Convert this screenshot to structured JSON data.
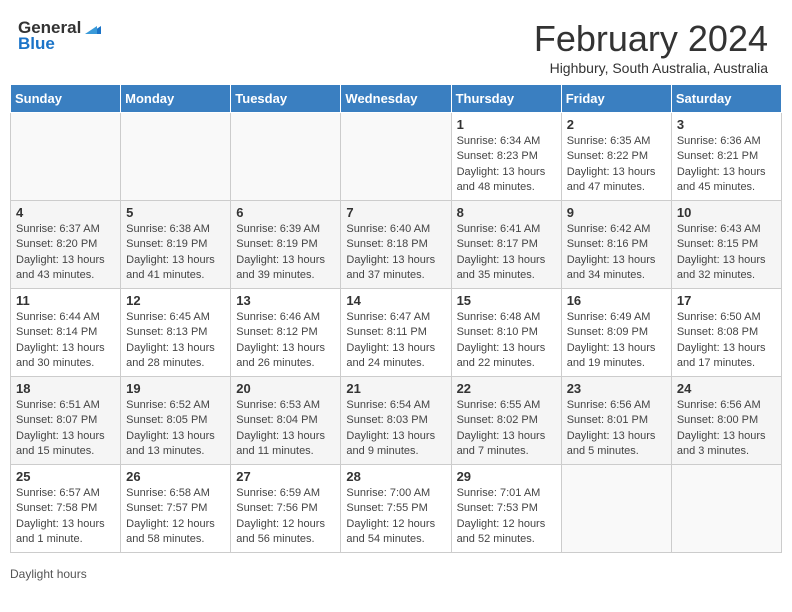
{
  "header": {
    "logo_general": "General",
    "logo_blue": "Blue",
    "title": "February 2024",
    "subtitle": "Highbury, South Australia, Australia"
  },
  "days_of_week": [
    "Sunday",
    "Monday",
    "Tuesday",
    "Wednesday",
    "Thursday",
    "Friday",
    "Saturday"
  ],
  "weeks": [
    [
      {
        "day": "",
        "info": ""
      },
      {
        "day": "",
        "info": ""
      },
      {
        "day": "",
        "info": ""
      },
      {
        "day": "",
        "info": ""
      },
      {
        "day": "1",
        "info": "Sunrise: 6:34 AM\nSunset: 8:23 PM\nDaylight: 13 hours and 48 minutes."
      },
      {
        "day": "2",
        "info": "Sunrise: 6:35 AM\nSunset: 8:22 PM\nDaylight: 13 hours and 47 minutes."
      },
      {
        "day": "3",
        "info": "Sunrise: 6:36 AM\nSunset: 8:21 PM\nDaylight: 13 hours and 45 minutes."
      }
    ],
    [
      {
        "day": "4",
        "info": "Sunrise: 6:37 AM\nSunset: 8:20 PM\nDaylight: 13 hours and 43 minutes."
      },
      {
        "day": "5",
        "info": "Sunrise: 6:38 AM\nSunset: 8:19 PM\nDaylight: 13 hours and 41 minutes."
      },
      {
        "day": "6",
        "info": "Sunrise: 6:39 AM\nSunset: 8:19 PM\nDaylight: 13 hours and 39 minutes."
      },
      {
        "day": "7",
        "info": "Sunrise: 6:40 AM\nSunset: 8:18 PM\nDaylight: 13 hours and 37 minutes."
      },
      {
        "day": "8",
        "info": "Sunrise: 6:41 AM\nSunset: 8:17 PM\nDaylight: 13 hours and 35 minutes."
      },
      {
        "day": "9",
        "info": "Sunrise: 6:42 AM\nSunset: 8:16 PM\nDaylight: 13 hours and 34 minutes."
      },
      {
        "day": "10",
        "info": "Sunrise: 6:43 AM\nSunset: 8:15 PM\nDaylight: 13 hours and 32 minutes."
      }
    ],
    [
      {
        "day": "11",
        "info": "Sunrise: 6:44 AM\nSunset: 8:14 PM\nDaylight: 13 hours and 30 minutes."
      },
      {
        "day": "12",
        "info": "Sunrise: 6:45 AM\nSunset: 8:13 PM\nDaylight: 13 hours and 28 minutes."
      },
      {
        "day": "13",
        "info": "Sunrise: 6:46 AM\nSunset: 8:12 PM\nDaylight: 13 hours and 26 minutes."
      },
      {
        "day": "14",
        "info": "Sunrise: 6:47 AM\nSunset: 8:11 PM\nDaylight: 13 hours and 24 minutes."
      },
      {
        "day": "15",
        "info": "Sunrise: 6:48 AM\nSunset: 8:10 PM\nDaylight: 13 hours and 22 minutes."
      },
      {
        "day": "16",
        "info": "Sunrise: 6:49 AM\nSunset: 8:09 PM\nDaylight: 13 hours and 19 minutes."
      },
      {
        "day": "17",
        "info": "Sunrise: 6:50 AM\nSunset: 8:08 PM\nDaylight: 13 hours and 17 minutes."
      }
    ],
    [
      {
        "day": "18",
        "info": "Sunrise: 6:51 AM\nSunset: 8:07 PM\nDaylight: 13 hours and 15 minutes."
      },
      {
        "day": "19",
        "info": "Sunrise: 6:52 AM\nSunset: 8:05 PM\nDaylight: 13 hours and 13 minutes."
      },
      {
        "day": "20",
        "info": "Sunrise: 6:53 AM\nSunset: 8:04 PM\nDaylight: 13 hours and 11 minutes."
      },
      {
        "day": "21",
        "info": "Sunrise: 6:54 AM\nSunset: 8:03 PM\nDaylight: 13 hours and 9 minutes."
      },
      {
        "day": "22",
        "info": "Sunrise: 6:55 AM\nSunset: 8:02 PM\nDaylight: 13 hours and 7 minutes."
      },
      {
        "day": "23",
        "info": "Sunrise: 6:56 AM\nSunset: 8:01 PM\nDaylight: 13 hours and 5 minutes."
      },
      {
        "day": "24",
        "info": "Sunrise: 6:56 AM\nSunset: 8:00 PM\nDaylight: 13 hours and 3 minutes."
      }
    ],
    [
      {
        "day": "25",
        "info": "Sunrise: 6:57 AM\nSunset: 7:58 PM\nDaylight: 13 hours and 1 minute."
      },
      {
        "day": "26",
        "info": "Sunrise: 6:58 AM\nSunset: 7:57 PM\nDaylight: 12 hours and 58 minutes."
      },
      {
        "day": "27",
        "info": "Sunrise: 6:59 AM\nSunset: 7:56 PM\nDaylight: 12 hours and 56 minutes."
      },
      {
        "day": "28",
        "info": "Sunrise: 7:00 AM\nSunset: 7:55 PM\nDaylight: 12 hours and 54 minutes."
      },
      {
        "day": "29",
        "info": "Sunrise: 7:01 AM\nSunset: 7:53 PM\nDaylight: 12 hours and 52 minutes."
      },
      {
        "day": "",
        "info": ""
      },
      {
        "day": "",
        "info": ""
      }
    ]
  ],
  "footer": {
    "daylight_label": "Daylight hours"
  }
}
